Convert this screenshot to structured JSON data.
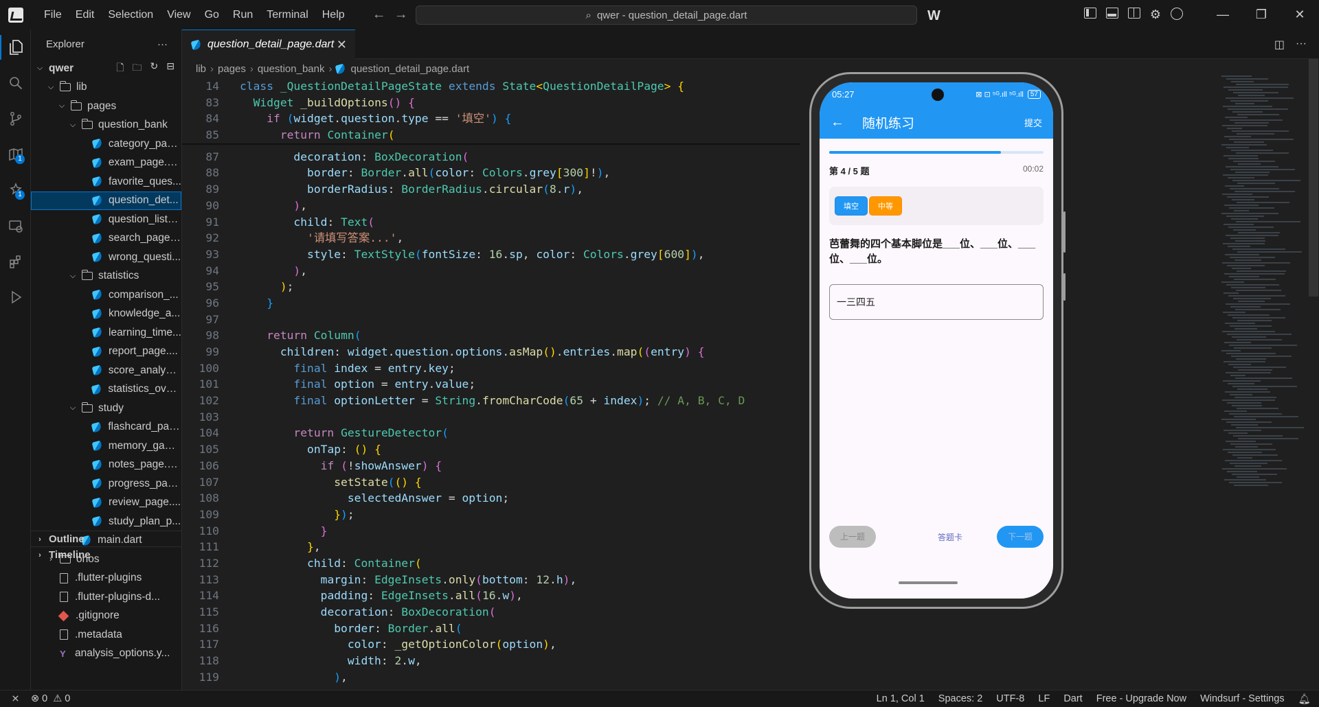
{
  "titlebar": {
    "menu": [
      "File",
      "Edit",
      "Selection",
      "View",
      "Go",
      "Run",
      "Terminal",
      "Help"
    ],
    "command_center": "qwer - question_detail_page.dart",
    "window_controls": [
      "—",
      "❐",
      "✕"
    ]
  },
  "activity": [
    "files-icon",
    "search-icon",
    "source-control-icon",
    "map-icon",
    "extensions-star-icon",
    "remote-icon",
    "extensions-icon",
    "run-debug-icon"
  ],
  "activity_badges": {
    "map": "1",
    "star": "1"
  },
  "sidebar": {
    "title": "Explorer",
    "more": "···",
    "root": "qwer",
    "tree": [
      {
        "label": "lib",
        "type": "folder",
        "open": true,
        "indent": 1
      },
      {
        "label": "pages",
        "type": "folder",
        "open": true,
        "indent": 2
      },
      {
        "label": "question_bank",
        "type": "folder",
        "open": true,
        "indent": 3
      },
      {
        "label": "category_pag...",
        "type": "dart",
        "indent": 4
      },
      {
        "label": "exam_page.d...",
        "type": "dart",
        "indent": 4
      },
      {
        "label": "favorite_ques...",
        "type": "dart",
        "indent": 4
      },
      {
        "label": "question_det...",
        "type": "dart",
        "indent": 4,
        "selected": true
      },
      {
        "label": "question_list_...",
        "type": "dart",
        "indent": 4
      },
      {
        "label": "search_page....",
        "type": "dart",
        "indent": 4
      },
      {
        "label": "wrong_questi...",
        "type": "dart",
        "indent": 4
      },
      {
        "label": "statistics",
        "type": "folder",
        "open": true,
        "indent": 3
      },
      {
        "label": "comparison_...",
        "type": "dart",
        "indent": 4
      },
      {
        "label": "knowledge_a...",
        "type": "dart",
        "indent": 4
      },
      {
        "label": "learning_time...",
        "type": "dart",
        "indent": 4
      },
      {
        "label": "report_page....",
        "type": "dart",
        "indent": 4
      },
      {
        "label": "score_analysi...",
        "type": "dart",
        "indent": 4
      },
      {
        "label": "statistics_over...",
        "type": "dart",
        "indent": 4
      },
      {
        "label": "study",
        "type": "folder",
        "open": true,
        "indent": 3
      },
      {
        "label": "flashcard_pag...",
        "type": "dart",
        "indent": 4
      },
      {
        "label": "memory_gam...",
        "type": "dart",
        "indent": 4
      },
      {
        "label": "notes_page.d...",
        "type": "dart",
        "indent": 4
      },
      {
        "label": "progress_pag...",
        "type": "dart",
        "indent": 4
      },
      {
        "label": "review_page....",
        "type": "dart",
        "indent": 4
      },
      {
        "label": "study_plan_p...",
        "type": "dart",
        "indent": 4
      },
      {
        "label": "main.dart",
        "type": "dart",
        "indent": 3
      },
      {
        "label": "ohos",
        "type": "folder",
        "open": false,
        "indent": 1
      },
      {
        "label": ".flutter-plugins",
        "type": "file",
        "indent": 1
      },
      {
        "label": ".flutter-plugins-d...",
        "type": "file",
        "indent": 1
      },
      {
        "label": ".gitignore",
        "type": "git",
        "indent": 1
      },
      {
        "label": ".metadata",
        "type": "file",
        "indent": 1
      },
      {
        "label": "analysis_options.y...",
        "type": "yaml",
        "indent": 1
      }
    ],
    "outline": "Outline",
    "timeline": "Timeline"
  },
  "editor": {
    "tab": "question_detail_page.dart",
    "breadcrumb": [
      "lib",
      "pages",
      "question_bank",
      "question_detail_page.dart"
    ],
    "sticky": [
      {
        "n": "14",
        "h": "<span class='k'>class</span> <span class='t'>_QuestionDetailPageState</span> <span class='k'>extends</span> <span class='t'>State</span><span class='p1'>&lt;</span><span class='t'>QuestionDetailPage</span><span class='p1'>&gt;</span> <span class='p1'>{</span>"
      },
      {
        "n": "83",
        "h": "  <span class='t'>Widget</span> <span class='f'>_buildOptions</span><span class='p2'>()</span> <span class='p2'>{</span>"
      },
      {
        "n": "84",
        "h": "    <span class='kc'>if</span> <span class='p3'>(</span><span class='v'>widget</span>.<span class='v'>question</span>.<span class='v'>type</span> == <span class='s'>'填空'</span><span class='p3'>)</span> <span class='p3'>{</span>"
      },
      {
        "n": "85",
        "h": "      <span class='kc'>return</span> <span class='t'>Container</span><span class='p1'>(</span>"
      }
    ],
    "lines": [
      {
        "n": "87",
        "h": "        <span class='v'>decoration</span>: <span class='t'>BoxDecoration</span><span class='p2'>(</span>"
      },
      {
        "n": "88",
        "h": "          <span class='v'>border</span>: <span class='t'>Border</span>.<span class='f'>all</span><span class='p3'>(</span><span class='v'>color</span>: <span class='t'>Colors</span>.<span class='v'>grey</span><span class='p1'>[</span><span class='n'>300</span><span class='p1'>]</span>!<span class='p3'>)</span>,"
      },
      {
        "n": "89",
        "h": "          <span class='v'>borderRadius</span>: <span class='t'>BorderRadius</span>.<span class='f'>circular</span><span class='p3'>(</span><span class='n'>8</span>.<span class='v'>r</span><span class='p3'>)</span>,"
      },
      {
        "n": "90",
        "h": "        <span class='p2'>)</span>,"
      },
      {
        "n": "91",
        "h": "        <span class='v'>child</span>: <span class='t'>Text</span><span class='p2'>(</span>"
      },
      {
        "n": "92",
        "h": "          <span class='s'>'请填写答案...'</span>,"
      },
      {
        "n": "93",
        "h": "          <span class='v'>style</span>: <span class='t'>TextStyle</span><span class='p3'>(</span><span class='v'>fontSize</span>: <span class='n'>16</span>.<span class='v'>sp</span>, <span class='v'>color</span>: <span class='t'>Colors</span>.<span class='v'>grey</span><span class='p1'>[</span><span class='n'>600</span><span class='p1'>]</span><span class='p3'>)</span>,"
      },
      {
        "n": "94",
        "h": "        <span class='p2'>)</span>,"
      },
      {
        "n": "95",
        "h": "      <span class='p1'>)</span>;"
      },
      {
        "n": "96",
        "h": "    <span class='p3'>}</span>"
      },
      {
        "n": "97",
        "h": ""
      },
      {
        "n": "98",
        "h": "    <span class='kc'>return</span> <span class='t'>Column</span><span class='p3'>(</span>"
      },
      {
        "n": "99",
        "h": "      <span class='v'>children</span>: <span class='v'>widget</span>.<span class='v'>question</span>.<span class='v'>options</span>.<span class='f'>asMap</span><span class='p1'>()</span>.<span class='v'>entries</span>.<span class='f'>map</span><span class='p1'>(</span><span class='p2'>(</span><span class='v'>entry</span><span class='p2'>)</span> <span class='p2'>{</span>"
      },
      {
        "n": "100",
        "h": "        <span class='k'>final</span> <span class='v'>index</span> = <span class='v'>entry</span>.<span class='v'>key</span>;"
      },
      {
        "n": "101",
        "h": "        <span class='k'>final</span> <span class='v'>option</span> = <span class='v'>entry</span>.<span class='v'>value</span>;"
      },
      {
        "n": "102",
        "h": "        <span class='k'>final</span> <span class='v'>optionLetter</span> = <span class='t'>String</span>.<span class='f'>fromCharCode</span><span class='p3'>(</span><span class='n'>65</span> + <span class='v'>index</span><span class='p3'>)</span>; <span class='c'>// A, B, C, D</span>"
      },
      {
        "n": "103",
        "h": ""
      },
      {
        "n": "104",
        "h": "        <span class='kc'>return</span> <span class='t'>GestureDetector</span><span class='p3'>(</span>"
      },
      {
        "n": "105",
        "h": "          <span class='v'>onTap</span>: <span class='p1'>()</span> <span class='p1'>{</span>"
      },
      {
        "n": "106",
        "h": "            <span class='kc'>if</span> <span class='p2'>(</span>!<span class='v'>showAnswer</span><span class='p2'>)</span> <span class='p2'>{</span>"
      },
      {
        "n": "107",
        "h": "              <span class='f'>setState</span><span class='p3'>(</span><span class='p1'>()</span> <span class='p1'>{</span>"
      },
      {
        "n": "108",
        "h": "                <span class='v'>selectedAnswer</span> = <span class='v'>option</span>;"
      },
      {
        "n": "109",
        "h": "              <span class='p1'>}</span><span class='p3'>)</span>;"
      },
      {
        "n": "110",
        "h": "            <span class='p2'>}</span>"
      },
      {
        "n": "111",
        "h": "          <span class='p1'>}</span>,"
      },
      {
        "n": "112",
        "h": "          <span class='v'>child</span>: <span class='t'>Container</span><span class='p1'>(</span>"
      },
      {
        "n": "113",
        "h": "            <span class='v'>margin</span>: <span class='t'>EdgeInsets</span>.<span class='f'>only</span><span class='p2'>(</span><span class='v'>bottom</span>: <span class='n'>12</span>.<span class='v'>h</span><span class='p2'>)</span>,"
      },
      {
        "n": "114",
        "h": "            <span class='v'>padding</span>: <span class='t'>EdgeInsets</span>.<span class='f'>all</span><span class='p2'>(</span><span class='n'>16</span>.<span class='v'>w</span><span class='p2'>)</span>,"
      },
      {
        "n": "115",
        "h": "            <span class='v'>decoration</span>: <span class='t'>BoxDecoration</span><span class='p2'>(</span>"
      },
      {
        "n": "116",
        "h": "              <span class='v'>border</span>: <span class='t'>Border</span>.<span class='f'>all</span><span class='p3'>(</span>"
      },
      {
        "n": "117",
        "h": "                <span class='v'>color</span>: <span class='f'>_getOptionColor</span><span class='p1'>(</span><span class='v'>option</span><span class='p1'>)</span>,"
      },
      {
        "n": "118",
        "h": "                <span class='v'>width</span>: <span class='n'>2</span>.<span class='v'>w</span>,"
      },
      {
        "n": "119",
        "h": "              <span class='p3'>)</span>,"
      }
    ]
  },
  "phone": {
    "time": "05:27",
    "status_icons": "⊠ ⊡ ⁵ᴳ.ıll ⁵ᴳ.ıll",
    "battery": "57",
    "back": "←",
    "title": "随机练习",
    "submit": "提交",
    "progress": 0.8,
    "question_count": "第 4 / 5 题",
    "timer": "00:02",
    "tag_type": "填空",
    "tag_difficulty": "中等",
    "question": "芭蕾舞的四个基本脚位是___位、___位、___位、___位。",
    "answer": "一三四五",
    "prev": "上一题",
    "answer_card": "答题卡",
    "next": "下一题"
  },
  "status": {
    "errors": "0",
    "warnings": "0",
    "position": "Ln 1, Col 1",
    "spaces": "Spaces: 2",
    "encoding": "UTF-8",
    "eol": "LF",
    "language": "Dart",
    "upgrade": "Free - Upgrade Now",
    "settings": "Windsurf - Settings"
  },
  "colors": {
    "accent": "#0078d4",
    "flutter_blue": "#2196f3",
    "orange": "#ff9800"
  }
}
